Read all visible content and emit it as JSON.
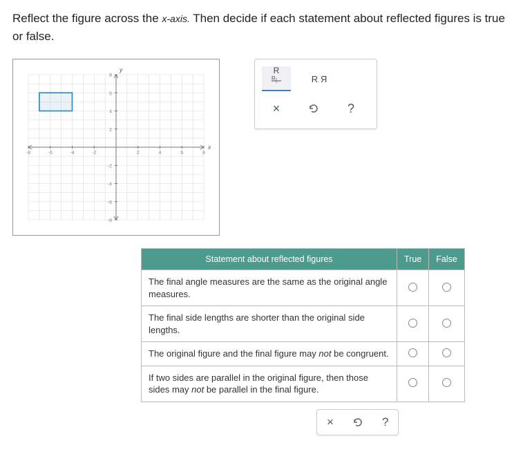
{
  "question": {
    "pre": "Reflect the figure across the ",
    "axis": "x-axis.",
    "post": " Then decide if each statement about reflected figures is true or false."
  },
  "graph": {
    "x_min": -8,
    "x_max": 8,
    "y_min": -8,
    "y_max": 8,
    "x_ticks": [
      -8,
      -6,
      -4,
      -2,
      2,
      4,
      6,
      8
    ],
    "y_ticks": [
      -8,
      -6,
      -4,
      -2,
      2,
      4,
      6,
      8
    ],
    "x_label": "x",
    "y_label": "y",
    "rect": {
      "x1": -7,
      "y1": 4,
      "x2": -4,
      "y2": 6
    }
  },
  "tools": {
    "reflect_h_label": "R",
    "flip_label": "R R",
    "close_label": "×",
    "undo_label": "↺",
    "help_label": "?"
  },
  "table": {
    "header_main": "Statement about reflected figures",
    "header_true": "True",
    "header_false": "False",
    "rows": [
      {
        "text": "The final angle measures are the same as the original angle measures.",
        "ital": ""
      },
      {
        "text": "The final side lengths are shorter than the original side lengths.",
        "ital": ""
      },
      {
        "text_pre": "The original figure and the final figure may ",
        "ital": "not",
        "text_post": " be congruent."
      },
      {
        "text_pre": "If two sides are parallel in the original figure, then those sides may ",
        "ital": "not",
        "text_post": " be parallel in the final figure."
      }
    ]
  },
  "bottom": {
    "close": "×",
    "undo": "↺",
    "help": "?"
  }
}
